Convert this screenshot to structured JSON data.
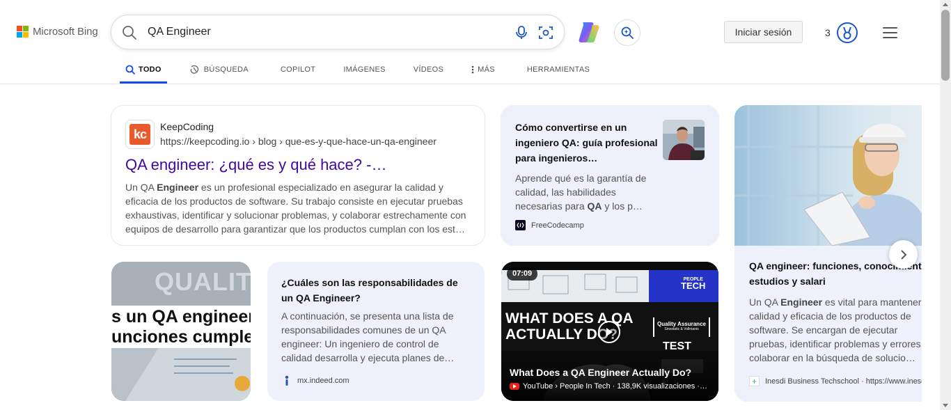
{
  "header": {
    "logo_text": "Microsoft Bing",
    "search_query": "QA Engineer",
    "signin_label": "Iniciar sesión",
    "points": "3"
  },
  "tabs": [
    {
      "label": "TODO",
      "active": true
    },
    {
      "label": "BÚSQUEDA",
      "active": false
    },
    {
      "label": "COPILOT",
      "active": false
    },
    {
      "label": "IMÁGENES",
      "active": false
    },
    {
      "label": "VÍDEOS",
      "active": false
    },
    {
      "label": "MÁS",
      "active": false
    },
    {
      "label": "HERRAMIENTAS",
      "active": false
    }
  ],
  "results": {
    "keepcoding": {
      "logo_text": "kc",
      "site_name": "KeepCoding",
      "url": "https://keepcoding.io › blog › que-es-y-que-hace-un-qa-engineer",
      "title": "QA engineer: ¿qué es y qué hace? -…",
      "snippet_pre": "Un QA ",
      "snippet_bold": "Engineer",
      "snippet_post": " es un profesional especializado en asegurar la calidad y eficacia de los productos de software. Su trabajo consiste en ejecutar pruebas exhaustivas, identificar y solucionar problemas, y colaborar estrechamente con equipos de desarrollo para garantizar que los productos cumplan con los est…"
    },
    "freecodecamp": {
      "title": "Cómo convertirse en un ingeniero QA: guía profesional para ingenieros…",
      "snippet_pre": "Aprende qué es la garantía de calidad, las habilidades necesarias para ",
      "snippet_bold": "QA",
      "snippet_post": " y los p…",
      "source": "FreeCodecamp"
    },
    "inesdi": {
      "title": "QA engineer: funciones, conocimientos, estudios y salari",
      "snippet_pre": "Un QA ",
      "snippet_bold": "Engineer",
      "snippet_post": " es vital para mantener la calidad y eficacia de los productos de software. Se encargan de ejecutar pruebas, identificar problemas y errores, y colaborar en la búsqueda de solucio…",
      "source": "Inesdi Business Techschool · https://www.inesdi.com"
    },
    "quality_image": {
      "overlay_top": "QUALITY",
      "overlay_line1": "s un QA engineer",
      "overlay_line2": "unciones cumple"
    },
    "indeed": {
      "title": "¿Cuáles son las responsabilidades de un QA Engineer?",
      "snippet": "A continuación, se presenta una lista de responsabilidades comunes de un QA engineer: Un ingeniero de control de calidad desarrolla y ejecuta planes de…",
      "source": "mx.indeed.com"
    },
    "video": {
      "duration": "07:09",
      "brand_line1": "PEOPLE",
      "brand_line2": "TECH",
      "overlay_line1": "WHAT DOES A QA",
      "overlay_line2": "ACTUALLY DO?",
      "qa_box": "Quality Assurance",
      "qa_box_sub": "Sinostatic & Vollmanis",
      "test_label": "TEST",
      "title": "What Does a QA Engineer Actually Do?",
      "meta": "YouTube › People In Tech · 138,9K visualizaciones ·…"
    }
  },
  "colors": {
    "accent": "#174ae4",
    "link": "#4007a2",
    "card_blue": "#eef0fb"
  }
}
